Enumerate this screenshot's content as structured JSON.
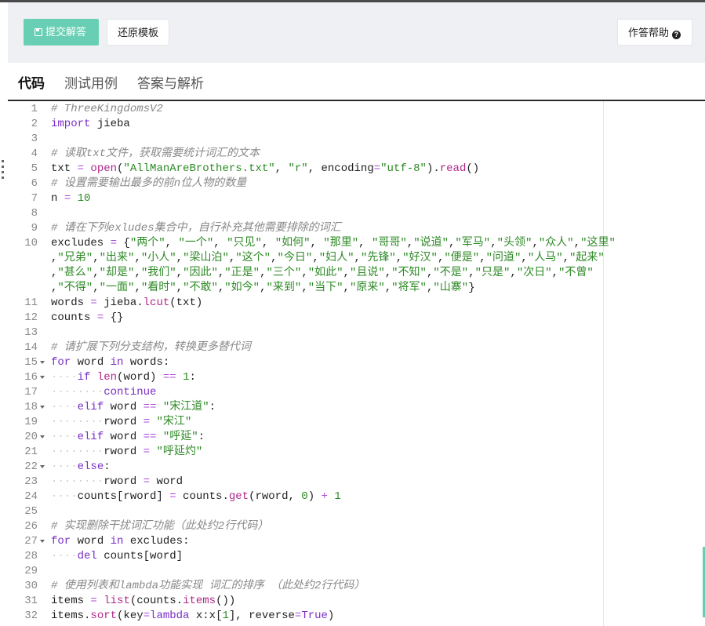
{
  "toolbar": {
    "submit_label": "提交解答",
    "restore_label": "还原模板",
    "help_label": "作答帮助"
  },
  "tabs": [
    {
      "label": "代码",
      "active": true
    },
    {
      "label": "测试用例",
      "active": false
    },
    {
      "label": "答案与解析",
      "active": false
    }
  ],
  "colors": {
    "accent": "#69cfb4",
    "comment": "#888888",
    "keyword": "#7a2fc4",
    "string": "#2d8a25",
    "function": "#b0288a"
  },
  "editor": {
    "lines": [
      {
        "n": "1",
        "fold": false,
        "tokens": [
          [
            "cm",
            "# ThreeKingdomsV2"
          ]
        ]
      },
      {
        "n": "2",
        "fold": false,
        "tokens": [
          [
            "kw",
            "import"
          ],
          [
            "tx",
            " jieba"
          ]
        ]
      },
      {
        "n": "3",
        "fold": false,
        "tokens": []
      },
      {
        "n": "4",
        "fold": false,
        "tokens": [
          [
            "cm",
            "# 读取txt文件，获取需要统计词汇的文本"
          ]
        ]
      },
      {
        "n": "5",
        "fold": false,
        "tokens": [
          [
            "tx",
            "txt "
          ],
          [
            "op",
            "="
          ],
          [
            "tx",
            " "
          ],
          [
            "fn",
            "open"
          ],
          [
            "tx",
            "("
          ],
          [
            "st",
            "\"AllManAreBrothers.txt\""
          ],
          [
            "tx",
            ", "
          ],
          [
            "st",
            "\"r\""
          ],
          [
            "tx",
            ", encoding"
          ],
          [
            "op",
            "="
          ],
          [
            "st",
            "\"utf-8\""
          ],
          [
            "tx",
            ")."
          ],
          [
            "fn",
            "read"
          ],
          [
            "tx",
            "()"
          ]
        ]
      },
      {
        "n": "6",
        "fold": false,
        "tokens": [
          [
            "cm",
            "# 设置需要输出最多的前n位人物的数量"
          ]
        ]
      },
      {
        "n": "7",
        "fold": false,
        "tokens": [
          [
            "tx",
            "n "
          ],
          [
            "op",
            "="
          ],
          [
            "tx",
            " "
          ],
          [
            "nm",
            "10"
          ]
        ]
      },
      {
        "n": "8",
        "fold": false,
        "tokens": []
      },
      {
        "n": "9",
        "fold": false,
        "tokens": [
          [
            "cm",
            "# 请在下列exludes集合中，自行补充其他需要排除的词汇"
          ]
        ]
      },
      {
        "n": "10",
        "fold": false,
        "tokens": [
          [
            "tx",
            "excludes "
          ],
          [
            "op",
            "="
          ],
          [
            "tx",
            " {"
          ],
          [
            "st",
            "\"两个\""
          ],
          [
            "tx",
            ", "
          ],
          [
            "st",
            "\"一个\""
          ],
          [
            "tx",
            ", "
          ],
          [
            "st",
            "\"只见\""
          ],
          [
            "tx",
            ", "
          ],
          [
            "st",
            "\"如何\""
          ],
          [
            "tx",
            ", "
          ],
          [
            "st",
            "\"那里\""
          ],
          [
            "tx",
            ", "
          ],
          [
            "st",
            "\"哥哥\""
          ],
          [
            "tx",
            ","
          ],
          [
            "st",
            "\"说道\""
          ],
          [
            "tx",
            ","
          ],
          [
            "st",
            "\"军马\""
          ],
          [
            "tx",
            ","
          ],
          [
            "st",
            "\"头领\""
          ],
          [
            "tx",
            ","
          ],
          [
            "st",
            "\"众人\""
          ],
          [
            "tx",
            ","
          ],
          [
            "st",
            "\"这里\""
          ]
        ]
      },
      {
        "n": "",
        "fold": false,
        "tokens": [
          [
            "tx",
            ","
          ],
          [
            "st",
            "\"兄弟\""
          ],
          [
            "tx",
            ","
          ],
          [
            "st",
            "\"出来\""
          ],
          [
            "tx",
            ","
          ],
          [
            "st",
            "\"小人\""
          ],
          [
            "tx",
            ","
          ],
          [
            "st",
            "\"梁山泊\""
          ],
          [
            "tx",
            ","
          ],
          [
            "st",
            "\"这个\""
          ],
          [
            "tx",
            ","
          ],
          [
            "st",
            "\"今日\""
          ],
          [
            "tx",
            ","
          ],
          [
            "st",
            "\"妇人\""
          ],
          [
            "tx",
            ","
          ],
          [
            "st",
            "\"先锋\""
          ],
          [
            "tx",
            ","
          ],
          [
            "st",
            "\"好汉\""
          ],
          [
            "tx",
            ","
          ],
          [
            "st",
            "\"便是\""
          ],
          [
            "tx",
            ","
          ],
          [
            "st",
            "\"问道\""
          ],
          [
            "tx",
            ","
          ],
          [
            "st",
            "\"人马\""
          ],
          [
            "tx",
            ","
          ],
          [
            "st",
            "\"起来\""
          ]
        ]
      },
      {
        "n": "",
        "fold": false,
        "tokens": [
          [
            "tx",
            ","
          ],
          [
            "st",
            "\"甚么\""
          ],
          [
            "tx",
            ","
          ],
          [
            "st",
            "\"却是\""
          ],
          [
            "tx",
            ","
          ],
          [
            "st",
            "\"我们\""
          ],
          [
            "tx",
            ","
          ],
          [
            "st",
            "\"因此\""
          ],
          [
            "tx",
            ","
          ],
          [
            "st",
            "\"正是\""
          ],
          [
            "tx",
            ","
          ],
          [
            "st",
            "\"三个\""
          ],
          [
            "tx",
            ","
          ],
          [
            "st",
            "\"如此\""
          ],
          [
            "tx",
            ","
          ],
          [
            "st",
            "\"且说\""
          ],
          [
            "tx",
            ","
          ],
          [
            "st",
            "\"不知\""
          ],
          [
            "tx",
            ","
          ],
          [
            "st",
            "\"不是\""
          ],
          [
            "tx",
            ","
          ],
          [
            "st",
            "\"只是\""
          ],
          [
            "tx",
            ","
          ],
          [
            "st",
            "\"次日\""
          ],
          [
            "tx",
            ","
          ],
          [
            "st",
            "\"不曾\""
          ]
        ]
      },
      {
        "n": "",
        "fold": false,
        "tokens": [
          [
            "tx",
            ","
          ],
          [
            "st",
            "\"不得\""
          ],
          [
            "tx",
            ","
          ],
          [
            "st",
            "\"一面\""
          ],
          [
            "tx",
            ","
          ],
          [
            "st",
            "\"看时\""
          ],
          [
            "tx",
            ","
          ],
          [
            "st",
            "\"不敢\""
          ],
          [
            "tx",
            ","
          ],
          [
            "st",
            "\"如今\""
          ],
          [
            "tx",
            ","
          ],
          [
            "st",
            "\"来到\""
          ],
          [
            "tx",
            ","
          ],
          [
            "st",
            "\"当下\""
          ],
          [
            "tx",
            ","
          ],
          [
            "st",
            "\"原来\""
          ],
          [
            "tx",
            ","
          ],
          [
            "st",
            "\"将军\""
          ],
          [
            "tx",
            ","
          ],
          [
            "st",
            "\"山寨\""
          ],
          [
            "tx",
            "}"
          ]
        ]
      },
      {
        "n": "11",
        "fold": false,
        "tokens": [
          [
            "tx",
            "words "
          ],
          [
            "op",
            "="
          ],
          [
            "tx",
            " jieba."
          ],
          [
            "fn",
            "lcut"
          ],
          [
            "tx",
            "(txt)"
          ]
        ]
      },
      {
        "n": "12",
        "fold": false,
        "tokens": [
          [
            "tx",
            "counts "
          ],
          [
            "op",
            "="
          ],
          [
            "tx",
            " {}"
          ]
        ]
      },
      {
        "n": "13",
        "fold": false,
        "tokens": []
      },
      {
        "n": "14",
        "fold": false,
        "tokens": [
          [
            "cm",
            "# 请扩展下列分支结构，转换更多替代词"
          ]
        ]
      },
      {
        "n": "15",
        "fold": true,
        "tokens": [
          [
            "kw",
            "for"
          ],
          [
            "tx",
            " word "
          ],
          [
            "kw",
            "in"
          ],
          [
            "tx",
            " words:"
          ]
        ]
      },
      {
        "n": "16",
        "fold": true,
        "tokens": [
          [
            "ws",
            "····"
          ],
          [
            "kw",
            "if"
          ],
          [
            "tx",
            " "
          ],
          [
            "bu",
            "len"
          ],
          [
            "tx",
            "(word) "
          ],
          [
            "op",
            "=="
          ],
          [
            "tx",
            " "
          ],
          [
            "nm",
            "1"
          ],
          [
            "tx",
            ":"
          ]
        ]
      },
      {
        "n": "17",
        "fold": false,
        "tokens": [
          [
            "ws",
            "········"
          ],
          [
            "kw",
            "continue"
          ]
        ]
      },
      {
        "n": "18",
        "fold": true,
        "tokens": [
          [
            "ws",
            "····"
          ],
          [
            "kw",
            "elif"
          ],
          [
            "tx",
            " word "
          ],
          [
            "op",
            "=="
          ],
          [
            "tx",
            " "
          ],
          [
            "st",
            "\"宋江道\""
          ],
          [
            "tx",
            ":"
          ]
        ]
      },
      {
        "n": "19",
        "fold": false,
        "tokens": [
          [
            "ws",
            "········"
          ],
          [
            "tx",
            "rword "
          ],
          [
            "op",
            "="
          ],
          [
            "tx",
            " "
          ],
          [
            "st",
            "\"宋江\""
          ]
        ]
      },
      {
        "n": "20",
        "fold": true,
        "tokens": [
          [
            "ws",
            "····"
          ],
          [
            "kw",
            "elif"
          ],
          [
            "tx",
            " word "
          ],
          [
            "op",
            "=="
          ],
          [
            "tx",
            " "
          ],
          [
            "st",
            "\"呼延\""
          ],
          [
            "tx",
            ":"
          ]
        ]
      },
      {
        "n": "21",
        "fold": false,
        "tokens": [
          [
            "ws",
            "········"
          ],
          [
            "tx",
            "rword "
          ],
          [
            "op",
            "="
          ],
          [
            "tx",
            " "
          ],
          [
            "st",
            "\"呼延灼\""
          ]
        ]
      },
      {
        "n": "22",
        "fold": true,
        "tokens": [
          [
            "ws",
            "····"
          ],
          [
            "kw",
            "else"
          ],
          [
            "tx",
            ":"
          ]
        ]
      },
      {
        "n": "23",
        "fold": false,
        "tokens": [
          [
            "ws",
            "········"
          ],
          [
            "tx",
            "rword "
          ],
          [
            "op",
            "="
          ],
          [
            "tx",
            " word"
          ]
        ]
      },
      {
        "n": "24",
        "fold": false,
        "tokens": [
          [
            "ws",
            "····"
          ],
          [
            "tx",
            "counts[rword] "
          ],
          [
            "op",
            "="
          ],
          [
            "tx",
            " counts."
          ],
          [
            "fn",
            "get"
          ],
          [
            "tx",
            "(rword, "
          ],
          [
            "nm",
            "0"
          ],
          [
            "tx",
            ") "
          ],
          [
            "op",
            "+"
          ],
          [
            "tx",
            " "
          ],
          [
            "nm",
            "1"
          ]
        ]
      },
      {
        "n": "25",
        "fold": false,
        "tokens": []
      },
      {
        "n": "26",
        "fold": false,
        "tokens": [
          [
            "cm",
            "# 实现删除干扰词汇功能（此处约2行代码）"
          ]
        ]
      },
      {
        "n": "27",
        "fold": true,
        "tokens": [
          [
            "kw",
            "for"
          ],
          [
            "tx",
            " word "
          ],
          [
            "kw",
            "in"
          ],
          [
            "tx",
            " excludes:"
          ]
        ]
      },
      {
        "n": "28",
        "fold": false,
        "tokens": [
          [
            "ws",
            "····"
          ],
          [
            "kw",
            "del"
          ],
          [
            "tx",
            " counts[word]"
          ]
        ]
      },
      {
        "n": "29",
        "fold": false,
        "tokens": []
      },
      {
        "n": "30",
        "fold": false,
        "tokens": [
          [
            "cm",
            "# 使用列表和lambda功能实现 词汇的排序 （此处约2行代码）"
          ]
        ]
      },
      {
        "n": "31",
        "fold": false,
        "tokens": [
          [
            "tx",
            "items "
          ],
          [
            "op",
            "="
          ],
          [
            "tx",
            " "
          ],
          [
            "bu",
            "list"
          ],
          [
            "tx",
            "(counts."
          ],
          [
            "fn",
            "items"
          ],
          [
            "tx",
            "())"
          ]
        ]
      },
      {
        "n": "32",
        "fold": false,
        "tokens": [
          [
            "tx",
            "items."
          ],
          [
            "fn",
            "sort"
          ],
          [
            "tx",
            "(key"
          ],
          [
            "op",
            "="
          ],
          [
            "kw",
            "lambda"
          ],
          [
            "tx",
            " x:x["
          ],
          [
            "nm",
            "1"
          ],
          [
            "tx",
            "], reverse"
          ],
          [
            "op",
            "="
          ],
          [
            "kw",
            "True"
          ],
          [
            "tx",
            ")"
          ]
        ]
      }
    ]
  }
}
